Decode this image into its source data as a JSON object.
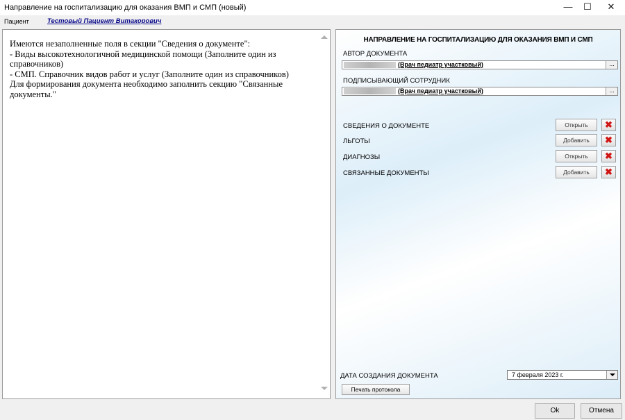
{
  "window": {
    "title": "Направление на госпитализацию для оказания ВМП и СМП (новый)",
    "minimize_glyph": "—",
    "maximize_glyph": "☐",
    "close_glyph": "✕"
  },
  "patient": {
    "label": "Пациент",
    "name": "Тестовый Пациент Витакорович"
  },
  "messages": [
    "Имеются незаполненные поля в секции \"Сведения о документе\":",
    "- Виды высокотехнологичной медицинской помощи (Заполните один из справочников)",
    "- СМП. Справочник видов работ и услуг (Заполните один из справочников)",
    "Для формирования документа необходимо заполнить секцию \"Связанные документы.\""
  ],
  "form": {
    "title": "НАПРАВЛЕНИЕ НА ГОСПИТАЛИЗАЦИЮ ДЛЯ ОКАЗАНИЯ ВМП И СМП",
    "author": {
      "label": "АВТОР ДОКУМЕНТА",
      "value": "(Врач педиатр участковый)",
      "button": "..."
    },
    "signer": {
      "label": "ПОДПИСЫВАЮЩИЙ СОТРУДНИК",
      "value": "(Врач педиатр участковый)",
      "button": "..."
    },
    "sections": [
      {
        "label": "СВЕДЕНИЯ О ДОКУМЕНТЕ",
        "action": "Открыть"
      },
      {
        "label": "ЛЬГОТЫ",
        "action": "Добавить"
      },
      {
        "label": "ДИАГНОЗЫ",
        "action": "Открыть"
      },
      {
        "label": "СВЯЗАННЫЕ ДОКУМЕНТЫ",
        "action": "Добавить"
      }
    ],
    "delete_glyph": "✖",
    "date_label": "ДАТА СОЗДАНИЯ ДОКУМЕНТА",
    "date_value": "7 февраля  2023 г.",
    "print_button": "Печать протокола"
  },
  "footer": {
    "ok": "Ok",
    "cancel": "Отмена"
  },
  "colors": {
    "patient_link": "#0a0a8a",
    "delete_icon": "#d01515",
    "panel_tint": "#ddeef9"
  }
}
